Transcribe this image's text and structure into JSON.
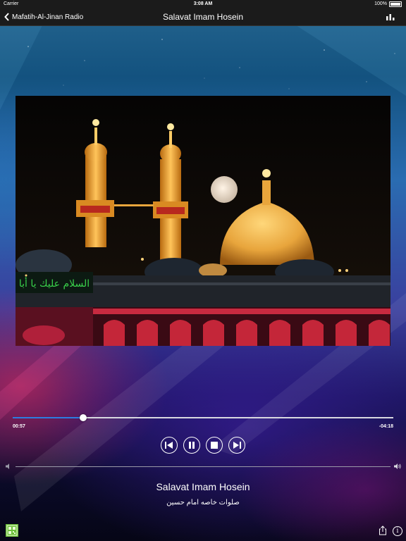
{
  "status_bar": {
    "carrier": "Carrier",
    "time": "3:08 AM",
    "battery": "100%"
  },
  "nav": {
    "back_label": "Mafatih-Al-Jinan Radio",
    "title": "Salavat Imam Hosein",
    "right_icon": "equalizer-icon"
  },
  "artwork": {
    "banner_text": "السلام عليك يا أبا",
    "colors": {
      "dome": "#e8a53c",
      "banner": "#39d04a",
      "arches": "#d42a3e"
    }
  },
  "player": {
    "elapsed": "00:57",
    "remaining": "-04:18",
    "progress_fraction": 0.185,
    "controls": [
      "previous-icon",
      "pause-icon",
      "stop-icon",
      "next-icon"
    ],
    "volume_level": 1.0
  },
  "track": {
    "title": "Salavat Imam Hosein",
    "subtitle": "صلوات خاصه امام حسين"
  },
  "bottom": {
    "left_icon": "qr-icon",
    "share_icon": "share-icon",
    "info_icon": "info-icon",
    "info_glyph": "i"
  },
  "colors": {
    "progress_fill": "#2d7ce0",
    "bar_bg": "#1b1b1b"
  }
}
